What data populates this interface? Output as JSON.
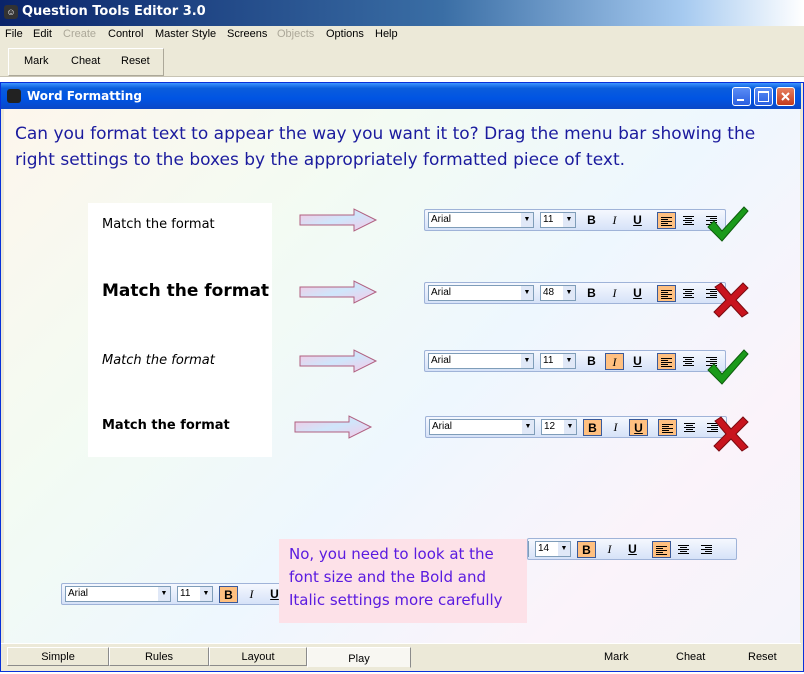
{
  "app": {
    "title": "Question Tools Editor 3.0"
  },
  "menu": [
    {
      "label": "File",
      "disabled": false
    },
    {
      "label": "Edit",
      "disabled": false
    },
    {
      "label": "Create",
      "disabled": true
    },
    {
      "label": "Control",
      "disabled": false
    },
    {
      "label": "Master Style",
      "disabled": false
    },
    {
      "label": "Screens",
      "disabled": false
    },
    {
      "label": "Objects",
      "disabled": true
    },
    {
      "label": "Options",
      "disabled": false
    },
    {
      "label": "Help",
      "disabled": false
    }
  ],
  "toolbar": {
    "mark": "Mark",
    "cheat": "Cheat",
    "reset": "Reset"
  },
  "window": {
    "title": "Word Formatting"
  },
  "question": "Can you format text to appear the way you want it to? Drag the menu bar showing the right settings  to the boxes by the appropriately formatted piece of text.",
  "samples": [
    {
      "text": "Match the format"
    },
    {
      "text": "Match the format"
    },
    {
      "text": "Match the format"
    },
    {
      "text": "Match the format"
    }
  ],
  "bars": [
    {
      "font": "Arial",
      "size": "11",
      "bold": false,
      "italic": false,
      "underline": false,
      "align": "left",
      "result": "correct"
    },
    {
      "font": "Arial",
      "size": "48",
      "bold": false,
      "italic": false,
      "underline": false,
      "align": "left",
      "result": "wrong"
    },
    {
      "font": "Arial",
      "size": "11",
      "bold": false,
      "italic": true,
      "underline": false,
      "align": "left",
      "result": "correct"
    },
    {
      "font": "Arial",
      "size": "12",
      "bold": true,
      "italic": false,
      "underline": true,
      "align": "left",
      "result": "wrong"
    },
    {
      "font": "",
      "size": "14",
      "bold": true,
      "italic": false,
      "underline": false,
      "align": "left"
    },
    {
      "font": "Arial",
      "size": "11",
      "bold": true,
      "italic": false,
      "underline": false,
      "align": "left"
    }
  ],
  "format_buttons": {
    "bold": "B",
    "italic": "I",
    "underline": "U"
  },
  "feedback": "No, you need to look at the font size and the  Bold and Italic settings more carefully",
  "bottom": {
    "tabs": [
      "Simple",
      "Rules",
      "Layout",
      "Play"
    ],
    "active_tab": "Play",
    "actions": [
      "Mark",
      "Cheat",
      "Reset"
    ]
  },
  "colors": {
    "question_text": "#1b1b9e",
    "feedback_text": "#5a1be0",
    "feedback_bg": "#fde1e8",
    "pressed": "#ffc080",
    "tick": "#1a9a1a",
    "cross": "#c8141e"
  }
}
